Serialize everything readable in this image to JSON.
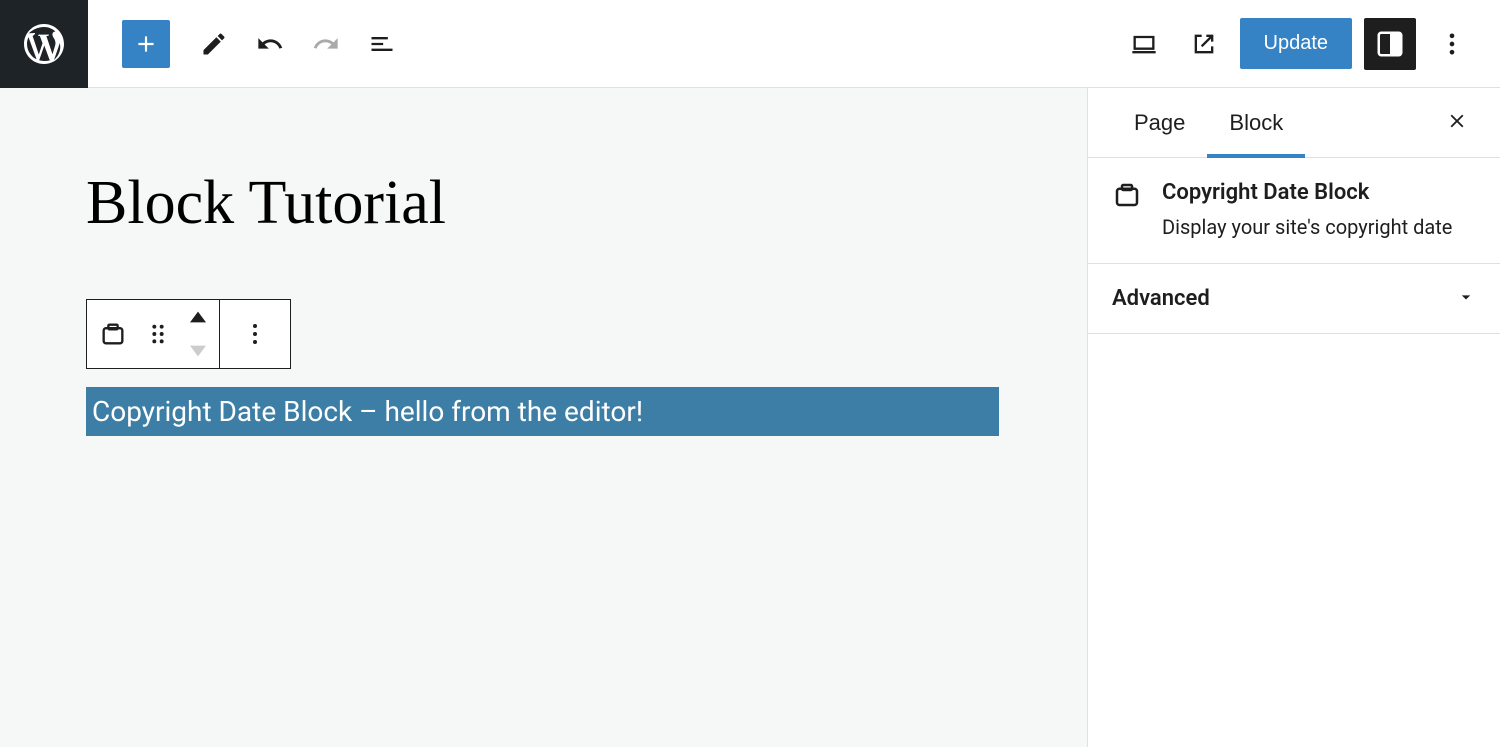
{
  "header": {
    "update_label": "Update"
  },
  "editor": {
    "page_title": "Block Tutorial",
    "selected_block_text": "Copyright Date Block – hello from the editor!"
  },
  "sidebar": {
    "tabs": {
      "page": "Page",
      "block": "Block"
    },
    "block_info": {
      "title": "Copyright Date Block",
      "description": "Display your site's copyright date"
    },
    "panels": {
      "advanced": "Advanced"
    }
  }
}
